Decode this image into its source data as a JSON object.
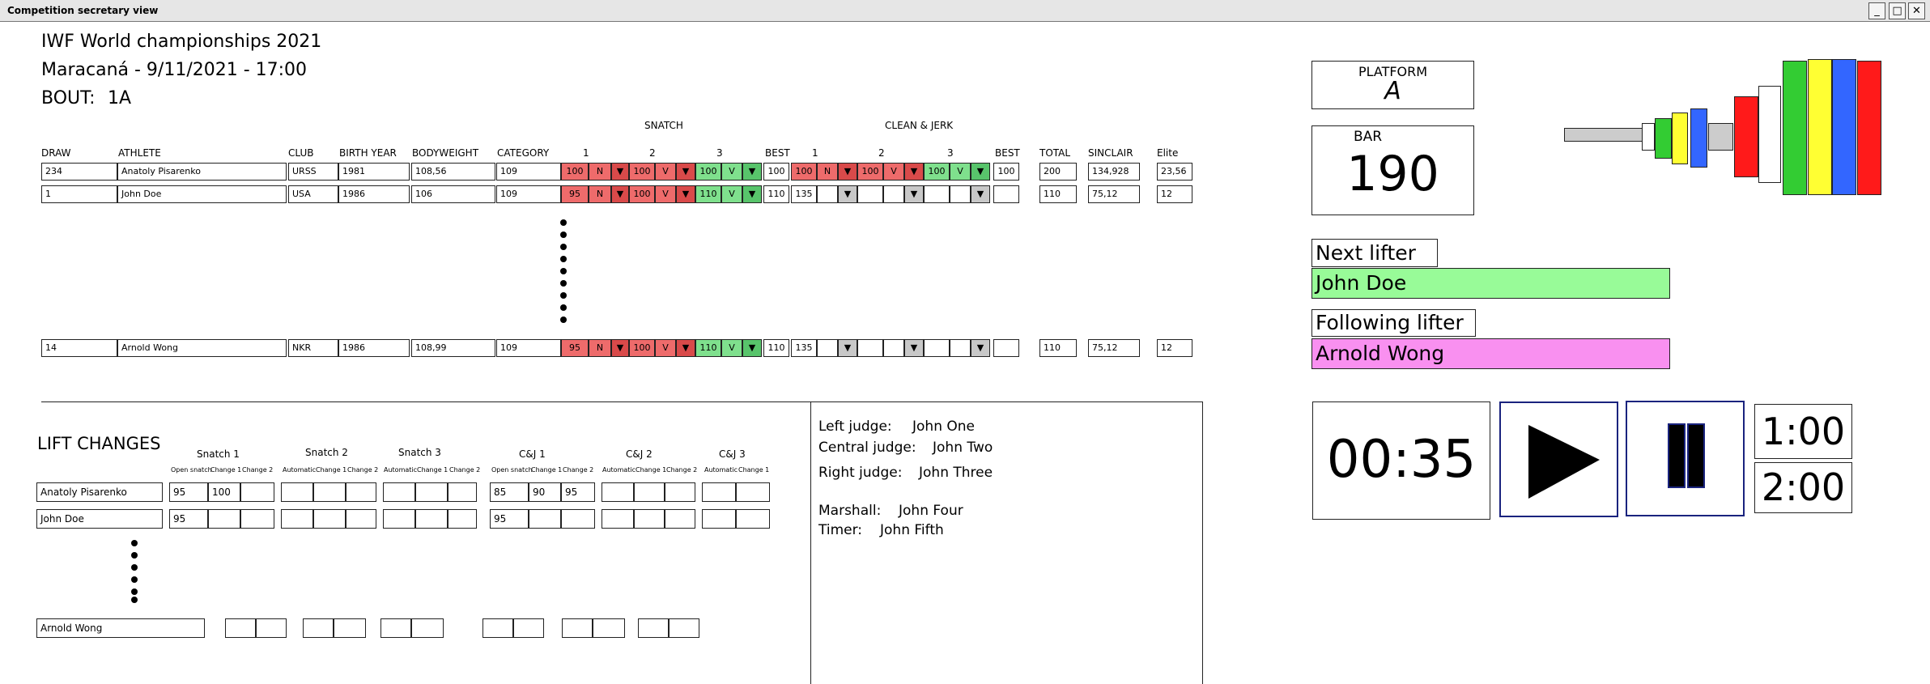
{
  "window": {
    "title": "Competition secretary view"
  },
  "header": {
    "title": "IWF World championships 2021",
    "venue_line": "Maracaná - 9/11/2021 - 17:00",
    "bout_label": "BOUT:",
    "bout_value": "1A"
  },
  "table": {
    "group_snatch": "SNATCH",
    "group_cj": "CLEAN & JERK",
    "columns": {
      "draw": "DRAW",
      "athlete": "ATHLETE",
      "club": "CLUB",
      "birth_year": "BIRTH YEAR",
      "bodyweight": "BODYWEIGHT",
      "category": "CATEGORY",
      "s1": "1",
      "s2": "2",
      "s3": "3",
      "sbest": "BEST",
      "c1": "1",
      "c2": "2",
      "c3": "3",
      "cbest": "BEST",
      "total": "TOTAL",
      "sinclair": "SINCLAIR",
      "elite": "Elite"
    },
    "rows": [
      {
        "draw": "234",
        "athlete": "Anatoly Pisarenko",
        "club": "URSS",
        "birth_year": "1981",
        "bodyweight": "108,56",
        "category": "109",
        "s1_w": "100",
        "s1_r": "N",
        "s2_w": "100",
        "s2_r": "V",
        "s3_w": "100",
        "s3_r": "V",
        "sbest": "100",
        "c1_w": "100",
        "c1_r": "N",
        "c2_w": "100",
        "c2_r": "V",
        "c3_w": "100",
        "c3_r": "V",
        "cbest": "100",
        "total": "200",
        "sinclair": "134,928",
        "elite": "23,56"
      },
      {
        "draw": "1",
        "athlete": "John Doe",
        "club": "USA",
        "birth_year": "1986",
        "bodyweight": "106",
        "category": "109",
        "s1_w": "95",
        "s1_r": "N",
        "s2_w": "100",
        "s2_r": "V",
        "s3_w": "110",
        "s3_r": "V",
        "sbest": "110",
        "c1_w": "135",
        "c1_r": "",
        "c2_w": "",
        "c2_r": "",
        "c3_w": "",
        "c3_r": "",
        "cbest": "",
        "total": "110",
        "sinclair": "75,12",
        "elite": "12"
      },
      {
        "draw": "14",
        "athlete": "Arnold Wong",
        "club": "NKR",
        "birth_year": "1986",
        "bodyweight": "108,99",
        "category": "109",
        "s1_w": "95",
        "s1_r": "N",
        "s2_w": "100",
        "s2_r": "V",
        "s3_w": "110",
        "s3_r": "V",
        "sbest": "110",
        "c1_w": "135",
        "c1_r": "",
        "c2_w": "",
        "c2_r": "",
        "c3_w": "",
        "c3_r": "",
        "cbest": "",
        "total": "110",
        "sinclair": "75,12",
        "elite": "12"
      }
    ],
    "dropdown_glyph": "▼"
  },
  "platform": {
    "label": "PLATFORM",
    "value": "A"
  },
  "bar": {
    "label": "BAR",
    "value": "190"
  },
  "next_lifter": {
    "label": "Next lifter",
    "name": "John Doe",
    "color": "#98fb98"
  },
  "following_lifter": {
    "label": "Following lifter",
    "name": "Arnold Wong",
    "color": "#f990f0"
  },
  "timer": {
    "display": "00:35",
    "preset_1": "1:00",
    "preset_2": "2:00",
    "play_icon": "play-icon",
    "pause_icon": "pause-icon"
  },
  "plates": {
    "colors": {
      "green": "#33cc33",
      "yellow": "#ffff33",
      "blue": "#3366ff",
      "red": "#ff1a1a",
      "white": "#ffffff",
      "bar_grey": "#cccccc"
    }
  },
  "lift_changes": {
    "title": "LIFT CHANGES",
    "groups": [
      "Snatch 1",
      "Snatch 2",
      "Snatch 3",
      "C&J 1",
      "C&J 2",
      "C&J 3"
    ],
    "sub_labels": {
      "g1": [
        "Open snatch",
        "Change 1",
        "Change 2"
      ],
      "g2": [
        "Automatic",
        "Change 1",
        "Change 2"
      ],
      "g3": [
        "Automatic",
        "Change 1",
        "Change 2"
      ],
      "g4": [
        "Open snatch",
        "Change 1",
        "Change 2"
      ],
      "g5": [
        "Automatic",
        "Change 1",
        "Change 2"
      ],
      "g6": [
        "Automatic",
        "Change 1"
      ]
    },
    "rows": [
      {
        "athlete": "Anatoly Pisarenko",
        "values": [
          "95",
          "100",
          "",
          "",
          "",
          "",
          "",
          "",
          "",
          "85",
          "90",
          "95",
          "",
          "",
          "",
          "",
          ""
        ]
      },
      {
        "athlete": "John Doe",
        "values": [
          "95",
          "",
          "",
          "",
          "",
          "",
          "",
          "",
          "",
          "95",
          "",
          "",
          "",
          "",
          "",
          "",
          ""
        ]
      },
      {
        "athlete": "Arnold Wong",
        "values": []
      }
    ]
  },
  "officials": {
    "left_judge_label": "Left judge:",
    "left_judge": "John One",
    "central_judge_label": "Central judge:",
    "central_judge": "John Two",
    "right_judge_label": "Right judge:",
    "right_judge": "John Three",
    "marshall_label": "Marshall:",
    "marshall": "John Four",
    "timer_label": "Timer:",
    "timer": "John Fifth"
  }
}
